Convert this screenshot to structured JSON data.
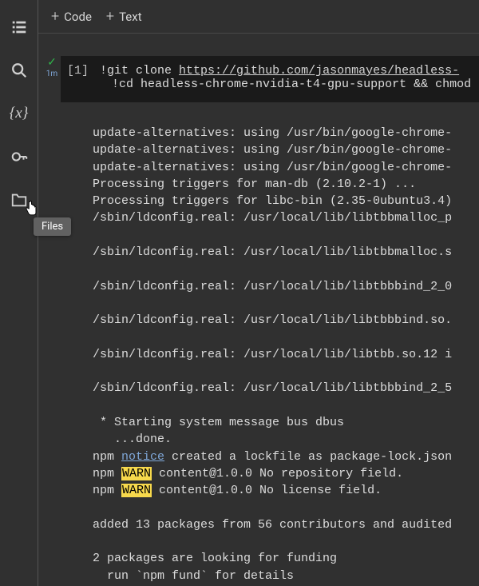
{
  "sidebar": {
    "items": [
      {
        "name": "toc-icon"
      },
      {
        "name": "search-icon"
      },
      {
        "name": "variables-icon"
      },
      {
        "name": "secrets-icon"
      },
      {
        "name": "files-icon"
      }
    ],
    "tooltip": "Files"
  },
  "toolbar": {
    "code_label": "Code",
    "text_label": "Text"
  },
  "cell": {
    "status_check": "✓",
    "status_time": "1m",
    "index": "[1]",
    "line1_bang": "!",
    "line1_cmd": "git clone ",
    "line1_url": "https://github.com/jasonmayes/headless-",
    "line2_bang": "!",
    "line2_cmd": "cd headless-chrome-nvidia-t4-gpu-support && chmod"
  },
  "output": {
    "l1": "update-alternatives: using /usr/bin/google-chrome-",
    "l2": "update-alternatives: using /usr/bin/google-chrome-",
    "l3": "update-alternatives: using /usr/bin/google-chrome-",
    "l4": "Processing triggers for man-db (2.10.2-1) ...",
    "l5": "Processing triggers for libc-bin (2.35-0ubuntu3.4)",
    "l6": "/sbin/ldconfig.real: /usr/local/lib/libtbbmalloc_p",
    "l7": "",
    "l8": "/sbin/ldconfig.real: /usr/local/lib/libtbbmalloc.s",
    "l9": "",
    "l10": "/sbin/ldconfig.real: /usr/local/lib/libtbbbind_2_0",
    "l11": "",
    "l12": "/sbin/ldconfig.real: /usr/local/lib/libtbbbind.so.",
    "l13": "",
    "l14": "/sbin/ldconfig.real: /usr/local/lib/libtbb.so.12 i",
    "l15": "",
    "l16": "/sbin/ldconfig.real: /usr/local/lib/libtbbbind_2_5",
    "l17": "",
    "l18": " * Starting system message bus dbus",
    "l19": "   ...done.",
    "npm1_pre": "npm ",
    "npm1_tag": "notice",
    "npm1_post": " created a lockfile as package-lock.json",
    "npm2_pre": "npm ",
    "npm2_tag": "WARN",
    "npm2_post": " content@1.0.0 No repository field.",
    "npm3_pre": "npm ",
    "npm3_tag": "WARN",
    "npm3_post": " content@1.0.0 No license field.",
    "l20": "",
    "l21": "added 13 packages from 56 contributors and audited",
    "l22": "",
    "l23": "2 packages are looking for funding",
    "l24": "  run `npm fund` for details"
  }
}
